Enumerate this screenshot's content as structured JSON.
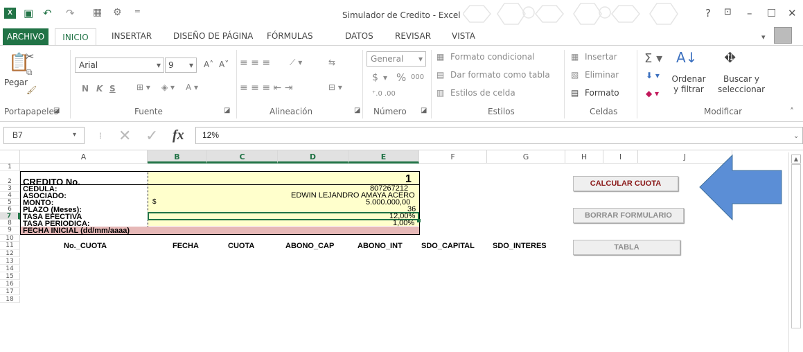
{
  "window": {
    "title": "Simulador de Credito - Excel",
    "help": "?",
    "restore": "⊡",
    "minimize": "–",
    "maximize": "□",
    "close": "✕"
  },
  "tabs": [
    "ARCHIVO",
    "INICIO",
    "INSERTAR",
    "DISEÑO DE PÁGINA",
    "FÓRMULAS",
    "DATOS",
    "REVISAR",
    "VISTA"
  ],
  "ribbon": {
    "clipboard": {
      "paste": "Pegar",
      "label": "Portapapeles"
    },
    "font": {
      "name": "Arial",
      "size": "9",
      "bold": "N",
      "italic": "K",
      "underline": "S",
      "label": "Fuente"
    },
    "alignment": {
      "label": "Alineación"
    },
    "number": {
      "format": "General",
      "currency": "$",
      "percent": "%",
      "thousands": "000",
      "label": "Número"
    },
    "styles": {
      "conditional": "Formato condicional",
      "table": "Dar formato como tabla",
      "cell": "Estilos de celda",
      "label": "Estilos"
    },
    "cells": {
      "insert": "Insertar",
      "delete": "Eliminar",
      "format": "Formato",
      "label": "Celdas"
    },
    "editing": {
      "sort": "Ordenar y filtrar",
      "find": "Buscar y seleccionar",
      "label": "Modificar"
    }
  },
  "formula": {
    "cell": "B7",
    "value": "12%"
  },
  "columns": [
    "A",
    "B",
    "C",
    "D",
    "E",
    "F",
    "G",
    "H",
    "I",
    "J"
  ],
  "rows": [
    "1",
    "2",
    "3",
    "4",
    "5",
    "6",
    "7",
    "8",
    "9",
    "10",
    "11",
    "12",
    "13",
    "14",
    "15",
    "16",
    "17",
    "18"
  ],
  "labels": [
    "CREDITO No.",
    "CEDULA:",
    "ASOCIADO:",
    "MONTO:",
    "PLAZO (Meses):",
    "TASA EFECTIVA",
    "TASA PERIODICA:",
    "FECHA INICIAL (dd/mm/aaaa)"
  ],
  "values": {
    "credit": "1",
    "cedula": "807267212",
    "asociado": "EDWIN LEJANDRO AMAYA ACERO",
    "monto": "5.000.000,00",
    "monto_currency": "$",
    "plazo": "36",
    "efectiva": "12,00%",
    "periodica": "1,00%"
  },
  "table_headers": [
    "No._CUOTA",
    "FECHA",
    "CUOTA",
    "ABONO_CAP",
    "ABONO_INT",
    "SDO_CAPITAL",
    "SDO_INTERES"
  ],
  "buttons": {
    "calc": "CALCULAR CUOTA",
    "clear": "BORRAR FORMULARIO",
    "table": "TABLA"
  },
  "colors": {
    "accent": "#217346",
    "arrow": "#5b8ed6",
    "calc_text": "#8b1a1a"
  }
}
